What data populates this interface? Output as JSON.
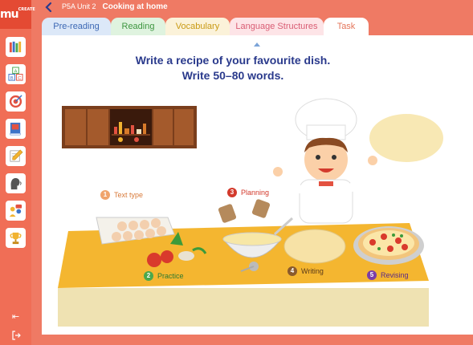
{
  "brand": {
    "logo": "mu",
    "sub": "CREATE"
  },
  "header": {
    "unit": "P5A Unit 2",
    "title": "Cooking at home"
  },
  "tabs": [
    {
      "label": "Pre-reading"
    },
    {
      "label": "Reading"
    },
    {
      "label": "Vocabulary"
    },
    {
      "label": "Language Structures"
    },
    {
      "label": "Task"
    }
  ],
  "task": {
    "line1": "Write a recipe of your favourite dish.",
    "line2": "Write 50–80 words."
  },
  "steps": [
    {
      "num": "1",
      "label": "Text type",
      "color": "#f0a46c"
    },
    {
      "num": "2",
      "label": "Practice",
      "color": "#4aa84c"
    },
    {
      "num": "3",
      "label": "Planning",
      "color": "#d33a2c"
    },
    {
      "num": "4",
      "label": "Writing",
      "color": "#8a5a2c"
    },
    {
      "num": "5",
      "label": "Revising",
      "color": "#7a3da8"
    }
  ],
  "rail_icons": [
    "books-icon",
    "abc-blocks-icon",
    "target-icon",
    "book-icon",
    "pencil-icon",
    "speaking-icon",
    "discussion-icon",
    "trophy-icon"
  ],
  "colors": {
    "accent": "#f06e56",
    "title_blue": "#2a3a8c"
  }
}
